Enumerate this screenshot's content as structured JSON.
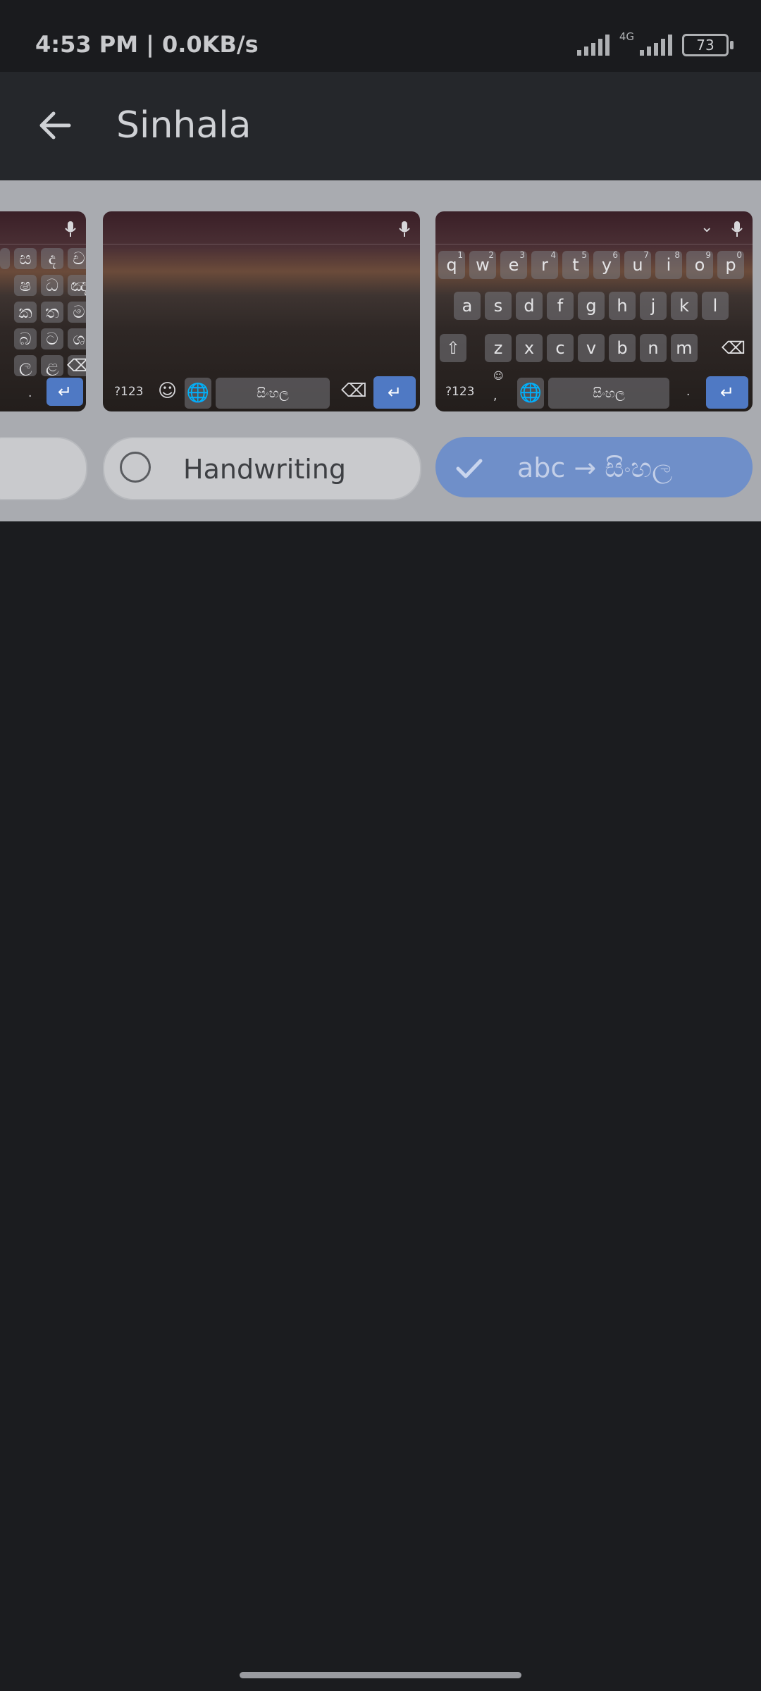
{
  "status": {
    "time": "4:53 PM | 0.0KB/s",
    "network": "4G",
    "battery": "73"
  },
  "appbar": {
    "title": "Sinhala"
  },
  "layouts": {
    "left_keys": [
      "ස",
      "ද",
      "ච",
      "ෂ",
      "ධ",
      "ඤ",
      "ක",
      "ත",
      "ම",
      "බ",
      "ට",
      "ශ",
      "ල",
      "ළ",
      "."
    ],
    "mid": {
      "symbols": "?123",
      "space": "සිංහල"
    },
    "right": {
      "row1": [
        "q",
        "w",
        "e",
        "r",
        "t",
        "y",
        "u",
        "i",
        "o",
        "p"
      ],
      "row1_hints": [
        "1",
        "2",
        "3",
        "4",
        "5",
        "6",
        "7",
        "8",
        "9",
        "0"
      ],
      "row2": [
        "a",
        "s",
        "d",
        "f",
        "g",
        "h",
        "j",
        "k",
        "l"
      ],
      "row3": [
        "z",
        "x",
        "c",
        "v",
        "b",
        "n",
        "m"
      ],
      "symbols": "?123",
      "comma": ",",
      "space": "සිංහල",
      "period": "."
    }
  },
  "options": {
    "handwriting": "Handwriting",
    "transliteration": "abc → සිංහල"
  },
  "colors": {
    "selected": "#6f8fc9",
    "enter_key": "#4f79c4"
  }
}
